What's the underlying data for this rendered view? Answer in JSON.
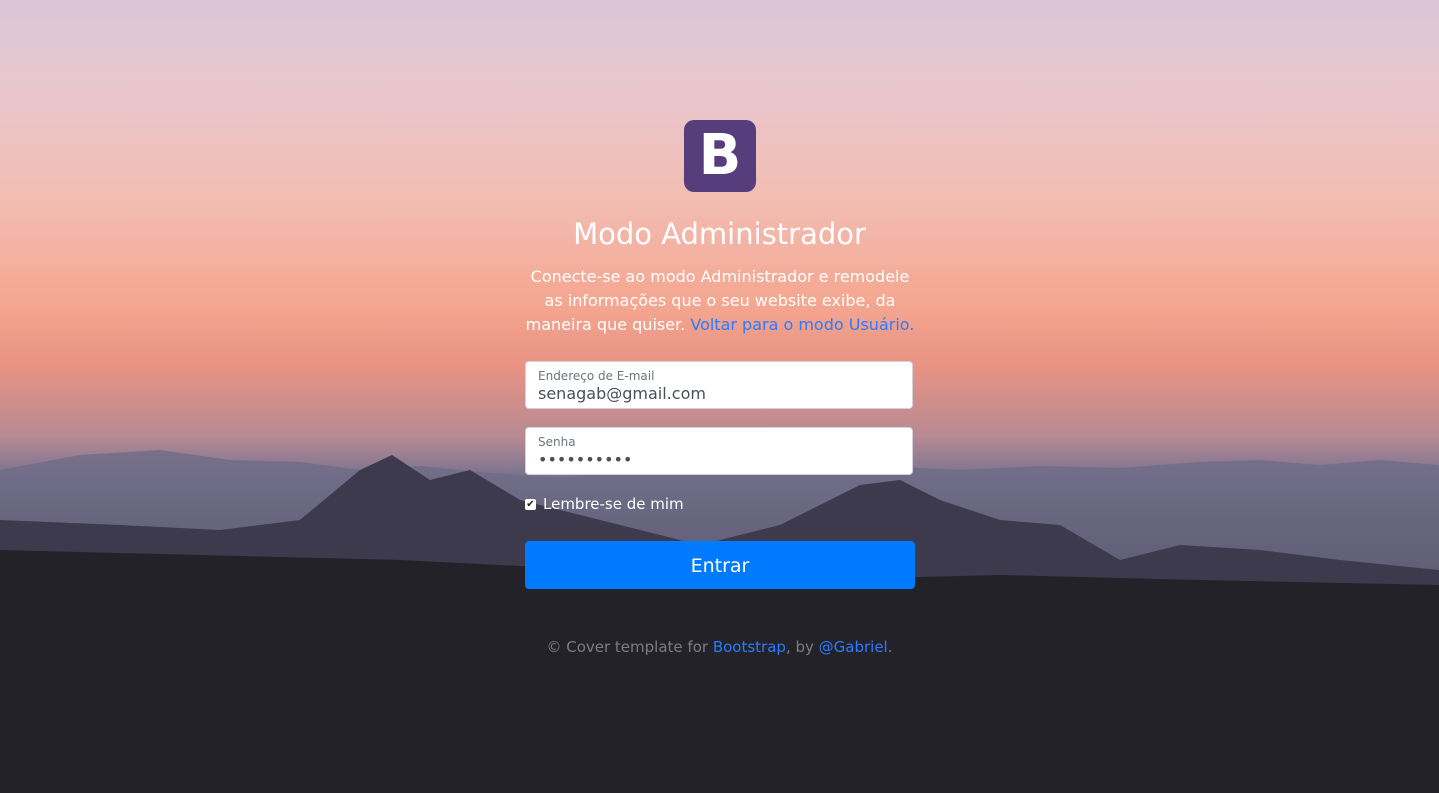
{
  "logo": {
    "letter": "B",
    "color": "#563d7c"
  },
  "heading": "Modo Administrador",
  "lead": {
    "text": "Conecte-se ao modo Administrador e remodele as informações que o seu website exibe, da maneira que quiser.",
    "link_label": "Voltar para o modo Usuário."
  },
  "form": {
    "email": {
      "label": "Endereço de E-mail",
      "value": "senagab@gmail.com"
    },
    "password": {
      "label": "Senha",
      "value": "••••••••••"
    },
    "remember": {
      "label": "Lembre-se de mim",
      "checked": true
    },
    "submit_label": "Entrar"
  },
  "footer": {
    "prefix": "© Cover template for",
    "link1": "Bootstrap",
    "middle": ", by",
    "link2": "@Gabriel",
    "suffix": "."
  },
  "colors": {
    "accent": "#007bff",
    "link": "#2a7bff"
  }
}
